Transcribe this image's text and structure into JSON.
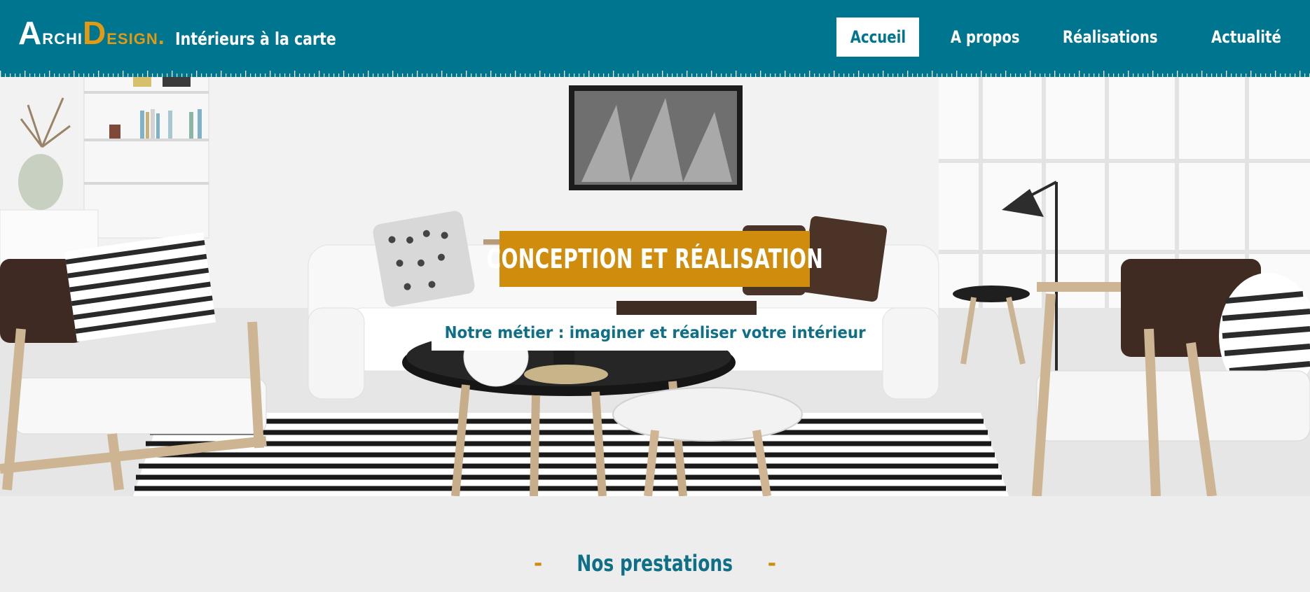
{
  "brand": {
    "logo_archi_first": "A",
    "logo_archi_rest": "rchi",
    "logo_design_first": "D",
    "logo_design_rest": "esign.",
    "tagline": "Intérieurs à la carte"
  },
  "nav": {
    "items": [
      {
        "label": "Accueil",
        "active": true
      },
      {
        "label": "A propos",
        "active": false
      },
      {
        "label": "Réalisations",
        "active": false
      },
      {
        "label": "Actualité",
        "active": false
      }
    ]
  },
  "hero": {
    "title": "CONCEPTION ET RÉALISATION",
    "subtitle": "Notre métier : imaginer et réaliser votre intérieur"
  },
  "section": {
    "dash_left": "-",
    "title": "Nos prestations",
    "dash_right": "-"
  },
  "colors": {
    "primary": "#007590",
    "accent": "#d08d0d",
    "text_teal": "#0e6f86",
    "background": "#ededed"
  }
}
